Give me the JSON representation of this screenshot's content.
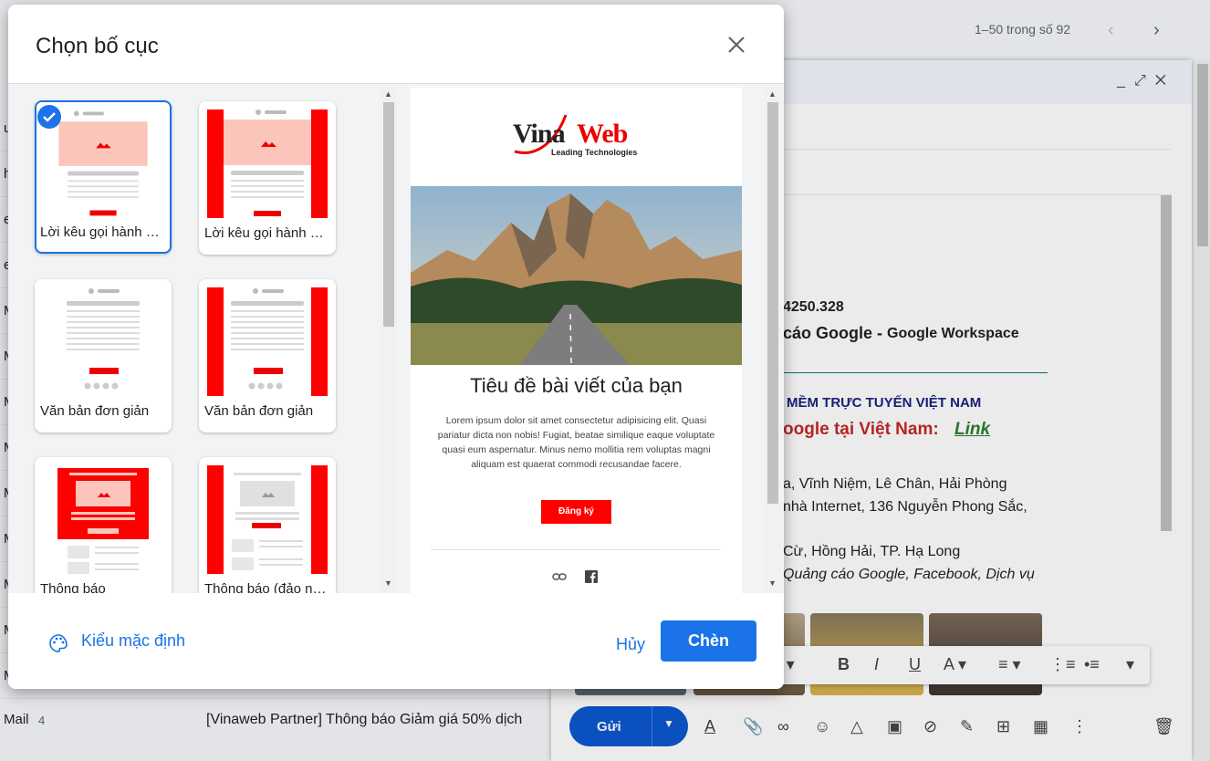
{
  "background": {
    "pager_text": "1–50 trong số 92",
    "rows": [
      "uy",
      "h",
      "ea",
      "ea",
      "Mi",
      "Mi",
      "Mi",
      "Mi",
      "Mi",
      "Mi",
      "Mi",
      "Mi",
      "Mi"
    ],
    "last_row_sender": "Mail",
    "last_row_count": "4",
    "last_row_subject": "[Vinaweb Partner] Thông báo Giảm giá 50% dịch",
    "compose_lines": {
      "phone": "4250.328",
      "service_bold": "cáo Google -",
      "service_rest": "Google Workspace",
      "company": "MỀM TRỰC TUYẾN VIỆT NAM",
      "google_vn": "oogle tại Việt Nam:",
      "link": "Link",
      "addr1": "a, Vĩnh Niệm, Lê Chân, Hải Phòng",
      "addr2": "nhà Internet, 136 Nguyễn Phong Sắc,",
      "addr3": "Cừ, Hồng Hải, TP. Hạ Long",
      "services": "Quảng cáo Google, Facebook, Dịch vụ"
    },
    "send_label": "Gửi"
  },
  "dialog": {
    "title": "Chọn bố cục",
    "cards": [
      {
        "label": "Lời kêu gọi hành động",
        "selected": true
      },
      {
        "label": "Lời kêu gọi hành động",
        "selected": false
      },
      {
        "label": "Văn bản đơn giản",
        "selected": false
      },
      {
        "label": "Văn bản đơn giản",
        "selected": false
      },
      {
        "label": "Thông báo",
        "selected": false
      },
      {
        "label": "Thông báo (đảo ngược)",
        "selected": false
      }
    ],
    "preview": {
      "logo_text_dark": "Vina",
      "logo_text_red": "Web",
      "logo_tagline": "Leading Technologies",
      "heading": "Tiêu đề bài viết của bạn",
      "body": "Lorem ipsum dolor sit amet consectetur adipisicing elit. Quasi pariatur dicta non nobis! Fugiat, beatae similique eaque voluptate quasi eum aspernatur. Minus nemo mollitia rem voluptas magni aliquam est quaerat commodi recusandae facere.",
      "cta": "Đăng ký"
    },
    "default_style": "Kiểu mặc định",
    "cancel": "Hủy",
    "insert": "Chèn"
  },
  "colors": {
    "accent": "#1a73e8",
    "brand_red": "#ff0000",
    "thumb_pink": "#fcc5bb"
  }
}
